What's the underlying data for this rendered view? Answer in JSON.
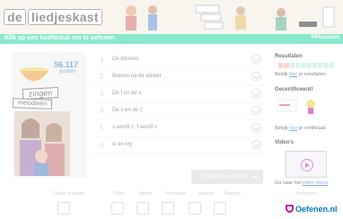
{
  "header": {
    "logo_prefix": "de",
    "logo_rest": "liedjeskast"
  },
  "subbar": {
    "message": "Klik op een hoofdstuk om te oefenen.",
    "account": "PPAccount"
  },
  "left": {
    "score": "56.117",
    "score_unit": "punten",
    "sign_zingen": "zingen",
    "sign_melodieen": "melodieën"
  },
  "exercises": [
    {
      "num": "1",
      "label": "De klinkers"
    },
    {
      "num": "2",
      "label": "Breken na de klinker"
    },
    {
      "num": "3",
      "label": "De f en de v"
    },
    {
      "num": "4",
      "label": "De s en de z"
    },
    {
      "num": "5",
      "label": "s wordt z, f wordt v"
    },
    {
      "num": "6",
      "label": "ei en eiy"
    }
  ],
  "start_button": "Volgende oefening",
  "right": {
    "results_title": "Resultaten",
    "results_text_prefix": "Bekijk ",
    "results_link": "hier",
    "results_text_suffix": " je resultaten.",
    "certified_title": "Gecertificeerd!",
    "cert_text_prefix": "Bekijk ",
    "cert_link": "hier",
    "cert_text_suffix": " je certificaat.",
    "videos_title": "Video's",
    "video_text_prefix": "Ga naar het ",
    "video_link": "video-menu",
    "video_text_suffix": "."
  },
  "footer": {
    "items": [
      {
        "label": "Ouder account"
      },
      {
        "label": "Video"
      },
      {
        "label": "Spelen"
      },
      {
        "label": "Woordkast"
      },
      {
        "label": "Rooster"
      },
      {
        "label": "Rapport"
      },
      {
        "label": "Verlengen"
      }
    ],
    "brand_text": "Oefenen.nl"
  },
  "colors": {
    "accent": "#2bd7a4",
    "score": "#2a7fc2",
    "link": "#1a6fd0",
    "brand": "#0077c8"
  }
}
